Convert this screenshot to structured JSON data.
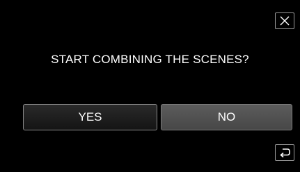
{
  "dialog": {
    "question": "START COMBINING THE SCENES?",
    "yes_label": "YES",
    "no_label": "NO"
  },
  "controls": {
    "close_icon": "close-icon",
    "return_icon": "return-icon"
  },
  "colors": {
    "background": "#000000",
    "text": "#ffffff",
    "yes_button": "#1e1e1e",
    "no_button": "#525252",
    "border": "#8a8a8a"
  }
}
